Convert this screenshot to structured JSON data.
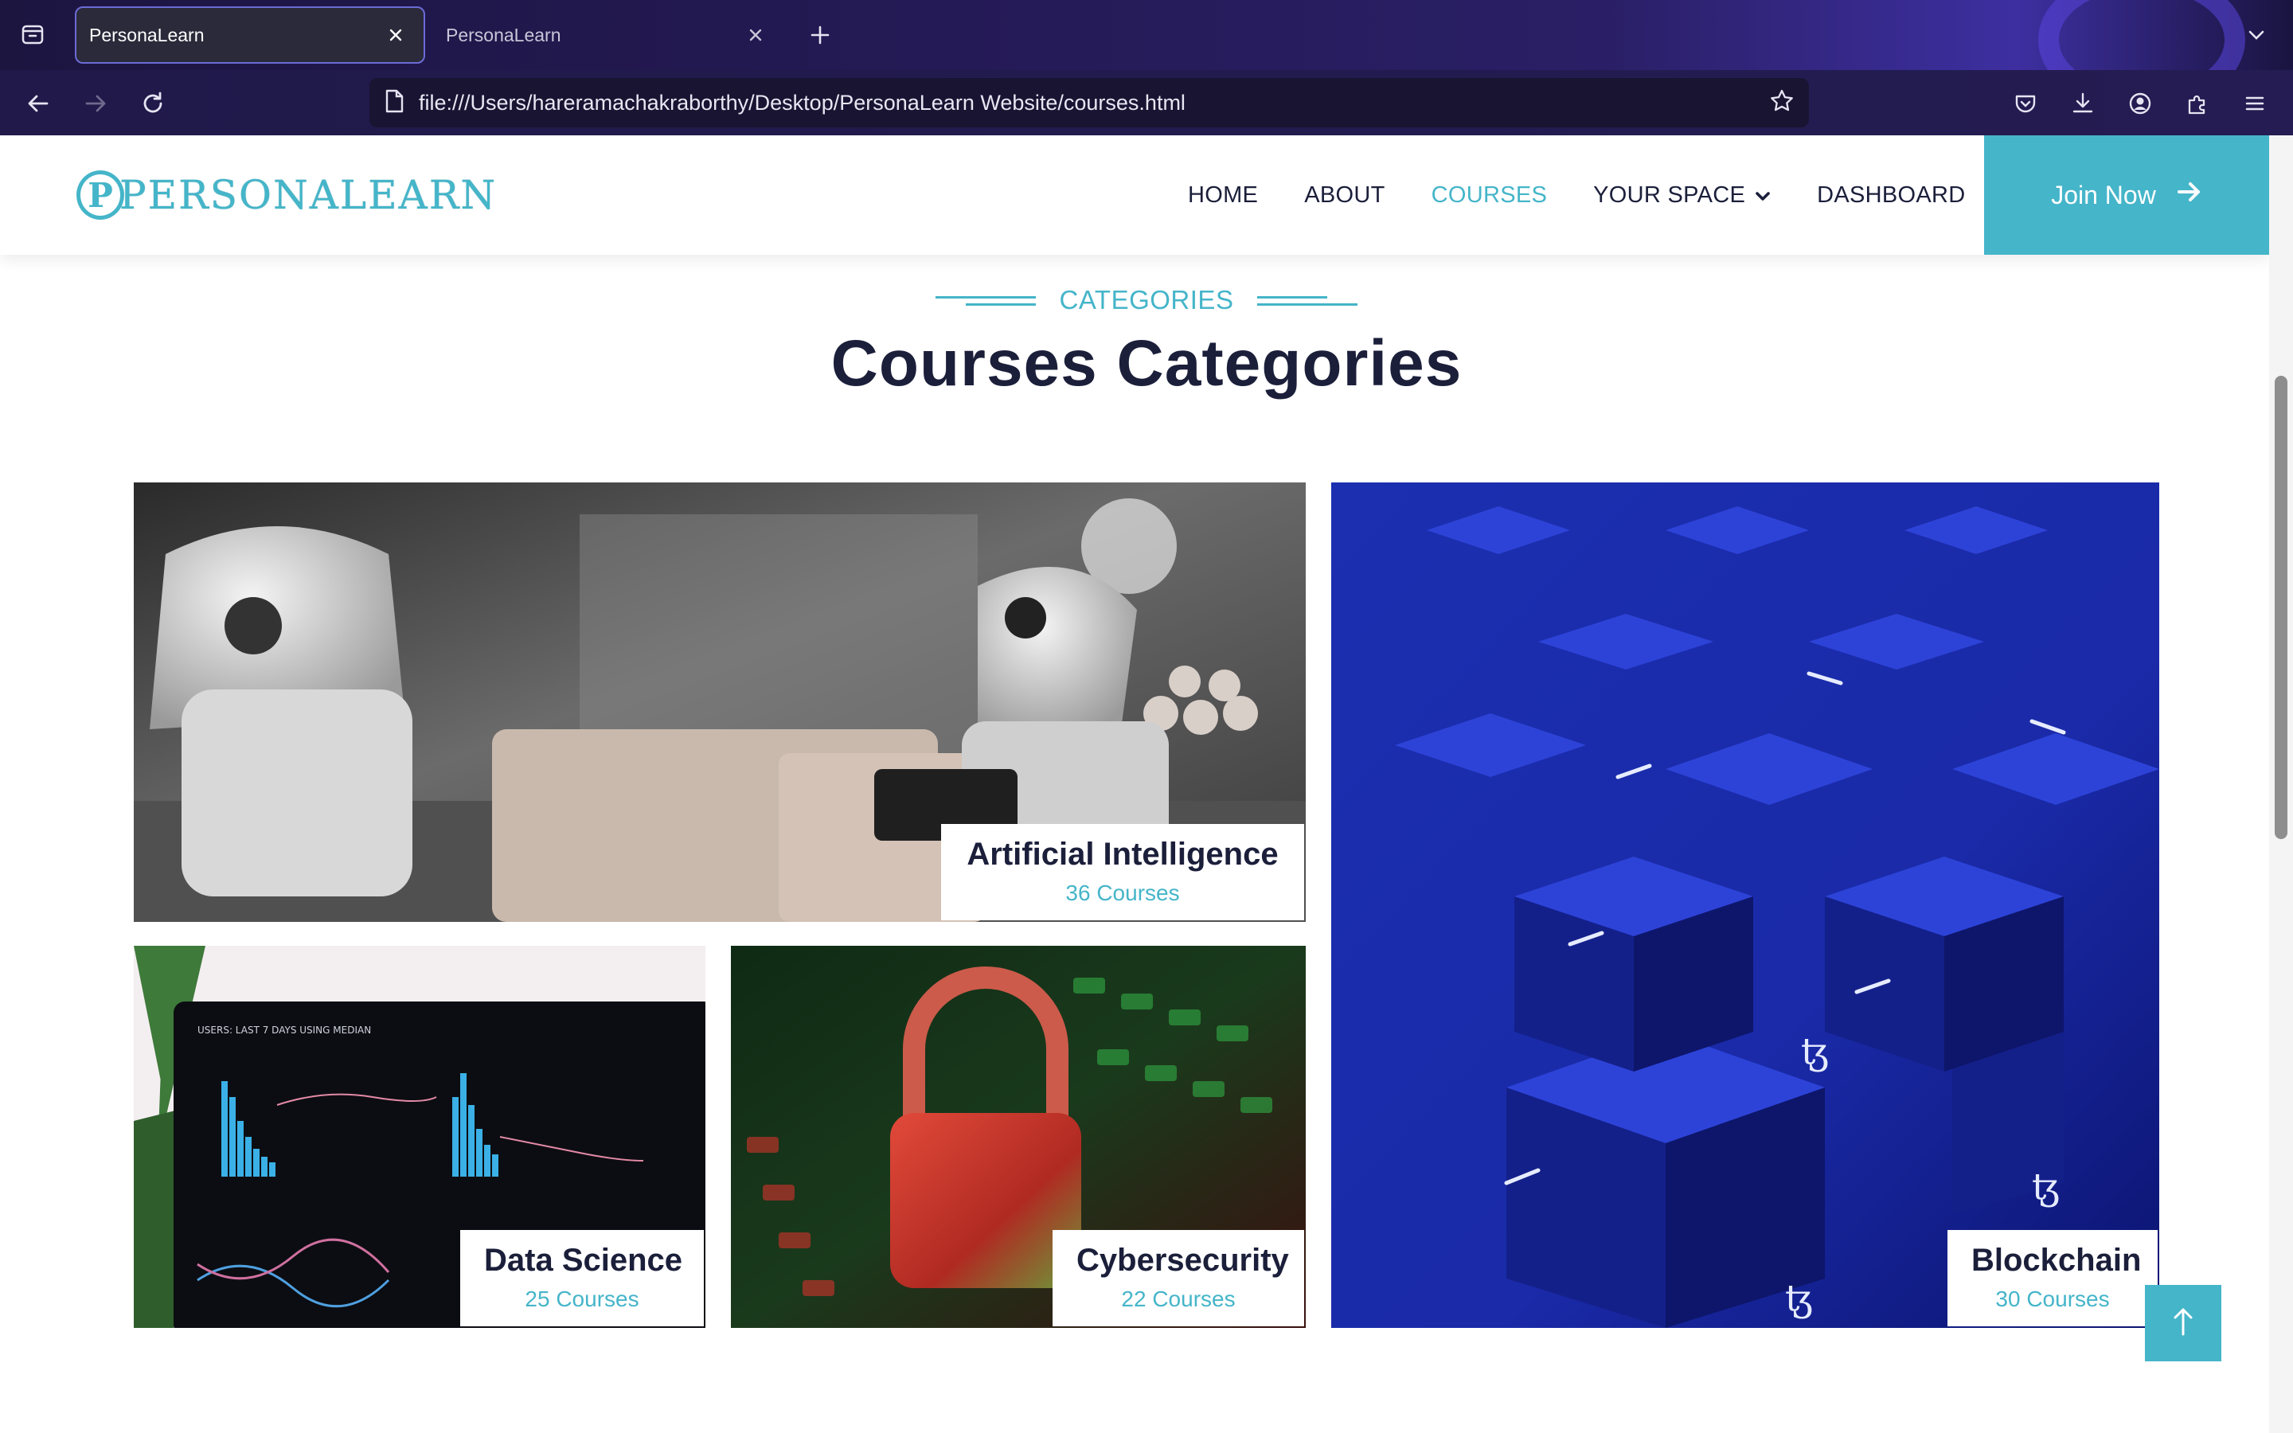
{
  "browser": {
    "tabs": [
      {
        "title": "PersonaLearn",
        "active": true
      },
      {
        "title": "PersonaLearn",
        "active": false
      }
    ],
    "url": "file:///Users/hareramachakraborthy/Desktop/PersonaLearn Website/courses.html"
  },
  "site": {
    "logo_text": "PERSONALEARN",
    "logo_mark": "P",
    "nav": [
      {
        "label": "HOME",
        "active": false
      },
      {
        "label": "ABOUT",
        "active": false
      },
      {
        "label": "COURSES",
        "active": true
      },
      {
        "label": "YOUR SPACE",
        "active": false,
        "dropdown": true
      },
      {
        "label": "DASHBOARD",
        "active": false
      }
    ],
    "join_label": "Join Now"
  },
  "section": {
    "subtitle": "CATEGORIES",
    "title": "Courses Categories"
  },
  "categories": [
    {
      "name": "Artificial Intelligence",
      "count": "36 Courses"
    },
    {
      "name": "Data Science",
      "count": "25 Courses"
    },
    {
      "name": "Cybersecurity",
      "count": "22 Courses"
    },
    {
      "name": "Blockchain",
      "count": "30 Courses"
    }
  ],
  "colors": {
    "accent": "#45b5c9",
    "heading": "#1b1f3a"
  }
}
